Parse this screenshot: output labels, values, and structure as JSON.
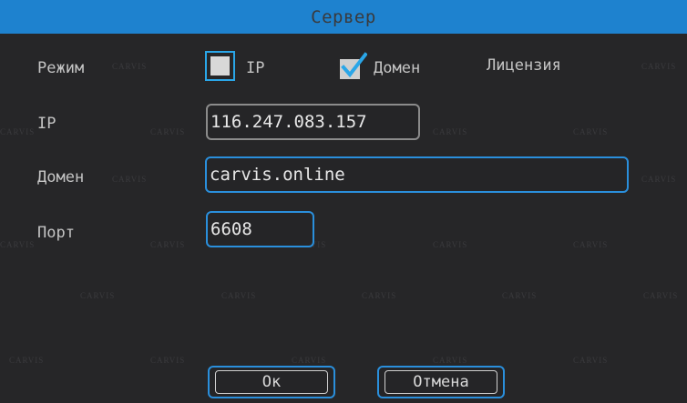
{
  "window": {
    "title": "Сервер"
  },
  "mode": {
    "label": "Режим",
    "option_ip": {
      "label": "IP",
      "checked": false
    },
    "option_domain": {
      "label": "Домен",
      "checked": true
    },
    "license_label": "Лицензия"
  },
  "ip": {
    "label": "IP",
    "value": "116.247.083.157"
  },
  "domain": {
    "label": "Домен",
    "value": "carvis.online"
  },
  "port": {
    "label": "Порт",
    "value": "6608"
  },
  "buttons": {
    "ok": "Ок",
    "cancel": "Отмена"
  },
  "watermark": "CARVIS",
  "colors": {
    "accent": "#2a8fdc",
    "title_bar": "#1e82cf",
    "background": "#262628"
  }
}
